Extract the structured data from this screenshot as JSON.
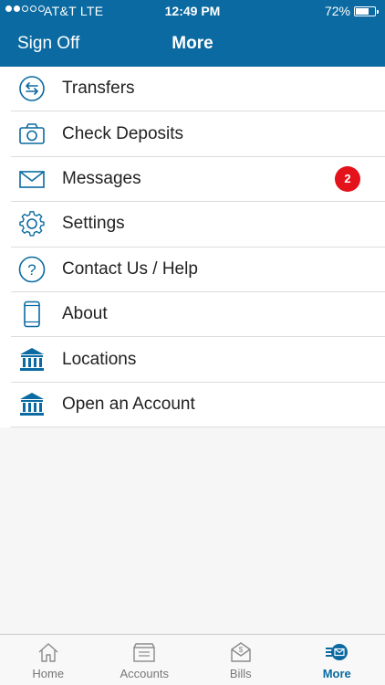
{
  "status_bar": {
    "carrier": "AT&T  LTE",
    "time": "12:49 PM",
    "battery": "72%"
  },
  "nav": {
    "left_button": "Sign Off",
    "title": "More"
  },
  "menu": {
    "items": [
      {
        "label": "Transfers",
        "icon": "transfer-arrows-icon"
      },
      {
        "label": "Check Deposits",
        "icon": "camera-icon"
      },
      {
        "label": "Messages",
        "icon": "envelope-icon",
        "badge": "2"
      },
      {
        "label": "Settings",
        "icon": "gear-icon"
      },
      {
        "label": "Contact Us / Help",
        "icon": "question-icon"
      },
      {
        "label": "About",
        "icon": "phone-icon"
      },
      {
        "label": "Locations",
        "icon": "bank-icon"
      },
      {
        "label": "Open an Account",
        "icon": "bank-icon"
      }
    ]
  },
  "tabs": {
    "items": [
      {
        "label": "Home",
        "icon": "home-icon"
      },
      {
        "label": "Accounts",
        "icon": "wallet-icon"
      },
      {
        "label": "Bills",
        "icon": "bill-envelope-icon"
      },
      {
        "label": "More",
        "icon": "more-icon",
        "active": true
      }
    ]
  },
  "colors": {
    "brand": "#0a6aa1",
    "badge": "#e3121b"
  }
}
